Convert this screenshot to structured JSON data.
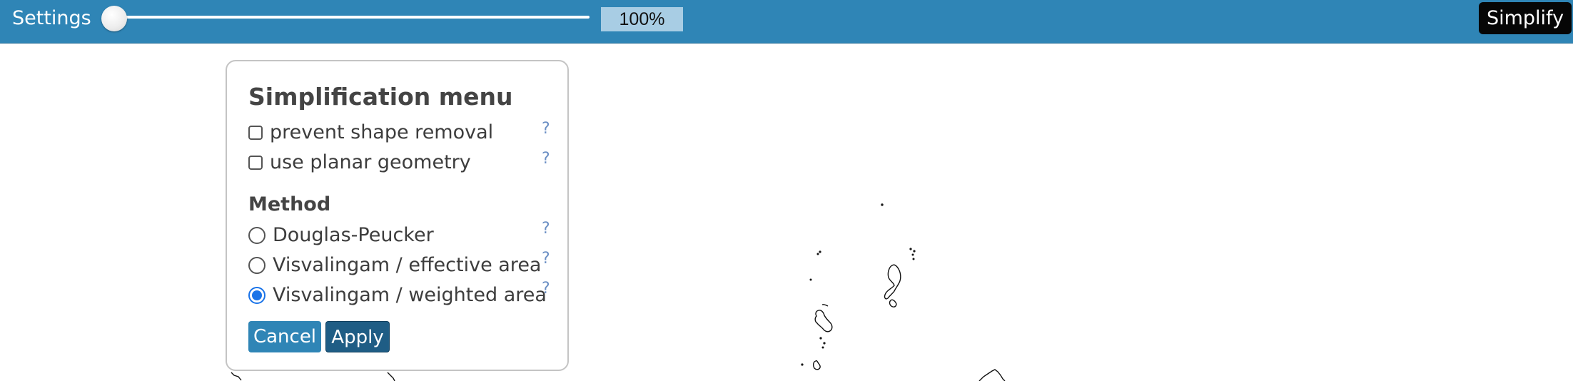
{
  "toolbar": {
    "settings_label": "Settings",
    "slider_percent": "100%",
    "simplify_label": "Simplify",
    "background_color": "#2f85b6"
  },
  "popup": {
    "title": "Simplification menu",
    "options": [
      {
        "label": "prevent shape removal",
        "checked": false,
        "help": "?"
      },
      {
        "label": "use planar geometry",
        "checked": false,
        "help": "?"
      }
    ],
    "method_label": "Method",
    "methods": [
      {
        "label": "Douglas-Peucker",
        "selected": false,
        "help": "?"
      },
      {
        "label": "Visvalingam / effective area",
        "selected": false,
        "help": "?"
      },
      {
        "label": "Visvalingam / weighted area",
        "selected": true,
        "help": "?"
      }
    ],
    "cancel_label": "Cancel",
    "apply_label": "Apply"
  }
}
